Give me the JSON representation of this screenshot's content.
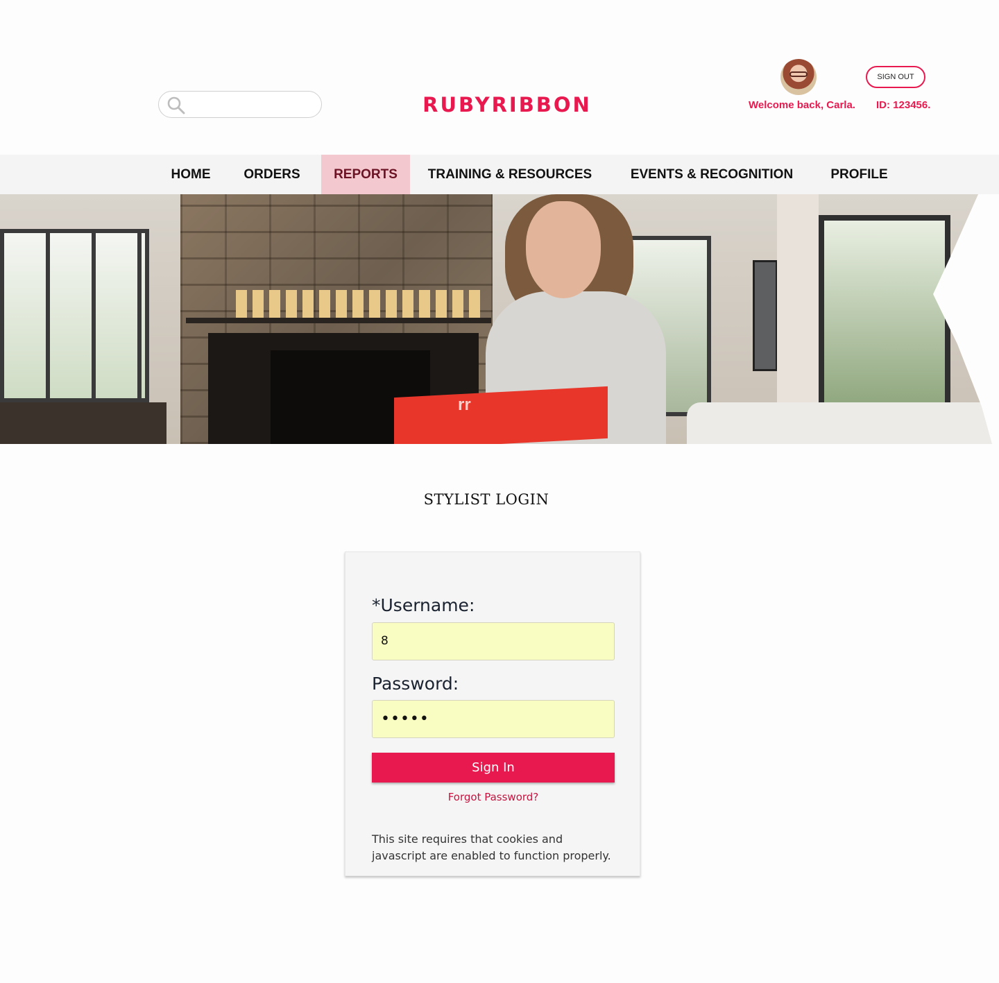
{
  "header": {
    "search": {
      "placeholder": "",
      "icon": "search-icon"
    },
    "logo": "RUBYRIBBON",
    "user": {
      "avatar": "avatar",
      "welcome": "Welcome back, Carla.",
      "id_text": "ID: 123456.",
      "sign_out_label": "SIGN OUT"
    }
  },
  "nav": {
    "items": [
      {
        "label": "HOME",
        "active": false
      },
      {
        "label": "ORDERS",
        "active": false
      },
      {
        "label": "REPORTS",
        "active": true
      },
      {
        "label": "TRAINING & RESOURCES",
        "active": false
      },
      {
        "label": "EVENTS & RECOGNITION",
        "active": false
      },
      {
        "label": "PROFILE",
        "active": false
      }
    ]
  },
  "hero": {
    "box_mark": "rr"
  },
  "login": {
    "title": "STYLIST LOGIN",
    "username_label": "*Username:",
    "username_value": "8",
    "password_label": "Password:",
    "password_value": "•••••",
    "sign_in_label": "Sign In",
    "forgot_label": "Forgot Password?",
    "notice": "This site requires that cookies and javascript are enabled to function properly."
  },
  "colors": {
    "brand": "#e8194f",
    "nav_active_bg": "#f3c9cf",
    "input_bg": "#fafdc1"
  }
}
